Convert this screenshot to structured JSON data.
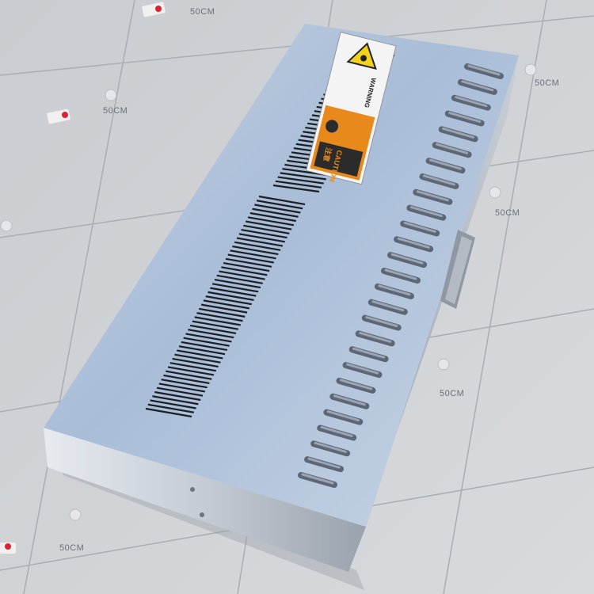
{
  "scene": {
    "description_free": true,
    "grid_scale_label": "50CM",
    "floor_color": "#cfd2d6",
    "device_color": "#b9c8dc"
  },
  "warning_label": {
    "warning_text": "WARNING",
    "caution_text": "CAUTION",
    "caution_cn": "注意",
    "colors": {
      "hazard_yellow": "#f2d21a",
      "label_orange": "#e8891c",
      "label_white": "#f4f4f4",
      "label_dark": "#2b2b2b"
    }
  }
}
